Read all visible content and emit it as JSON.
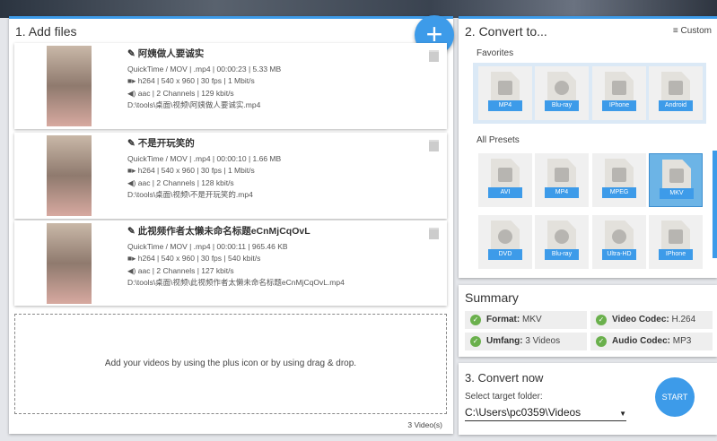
{
  "add_files": {
    "title": "1. Add files",
    "add_icon": "plus-icon",
    "count": "3 Video(s)",
    "drop_text": "Add your videos by using the plus icon or by using drag & drop.",
    "files": [
      {
        "title": "阿姨做人要诚实",
        "container": "QuickTime / MOV | .mp4 | 00:00:23 | 5.33 MB",
        "video": "h264 | 540 x 960 | 30 fps | 1 Mbit/s",
        "audio": "aac | 2 Channels | 129 kbit/s",
        "path": "D:\\tools\\桌面\\视频\\阿姨做人要诚实.mp4"
      },
      {
        "title": "不是开玩笑的",
        "container": "QuickTime / MOV | .mp4 | 00:00:10 | 1.66 MB",
        "video": "h264 | 540 x 960 | 30 fps | 1 Mbit/s",
        "audio": "aac | 2 Channels | 128 kbit/s",
        "path": "D:\\tools\\桌面\\视频\\不是开玩笑的.mp4"
      },
      {
        "title": "此视频作者太懒未命名标题eCnMjCqOvL",
        "container": "QuickTime / MOV | .mp4 | 00:00:11 | 965.46 KB",
        "video": "h264 | 540 x 960 | 30 fps | 540 kbit/s",
        "audio": "aac | 2 Channels | 127 kbit/s",
        "path": "D:\\tools\\桌面\\视频\\此视频作者太懒未命名标题eCnMjCqOvL.mp4"
      }
    ]
  },
  "convert_to": {
    "title": "2. Convert to...",
    "custom": "≡ Custom",
    "favorites_label": "Favorites",
    "presets_label": "All Presets",
    "favorites": [
      {
        "label": "MP4",
        "icon": "film"
      },
      {
        "label": "Blu-ray",
        "icon": "disc"
      },
      {
        "label": "IPhone",
        "icon": "phone"
      },
      {
        "label": "Android",
        "icon": "phone"
      }
    ],
    "presets": [
      {
        "label": "AVI",
        "icon": "film"
      },
      {
        "label": "MP4",
        "icon": "film"
      },
      {
        "label": "MPEG",
        "icon": "film"
      },
      {
        "label": "MKV",
        "icon": "film",
        "selected": true
      },
      {
        "label": "DVD",
        "icon": "disc"
      },
      {
        "label": "Blu-ray",
        "icon": "disc"
      },
      {
        "label": "Ultra-HD",
        "icon": "disc"
      },
      {
        "label": "IPhone",
        "icon": "phone"
      }
    ]
  },
  "summary": {
    "title": "Summary",
    "items": [
      {
        "key": "Format:",
        "value": " MKV"
      },
      {
        "key": "Video Codec:",
        "value": " H.264"
      },
      {
        "key": "Umfang:",
        "value": " 3 Videos"
      },
      {
        "key": "Audio Codec:",
        "value": " MP3"
      }
    ]
  },
  "convert_now": {
    "title": "3. Convert now",
    "folder_label": "Select target folder:",
    "folder": "C:\\Users\\pc0359\\Videos",
    "start": "START"
  }
}
